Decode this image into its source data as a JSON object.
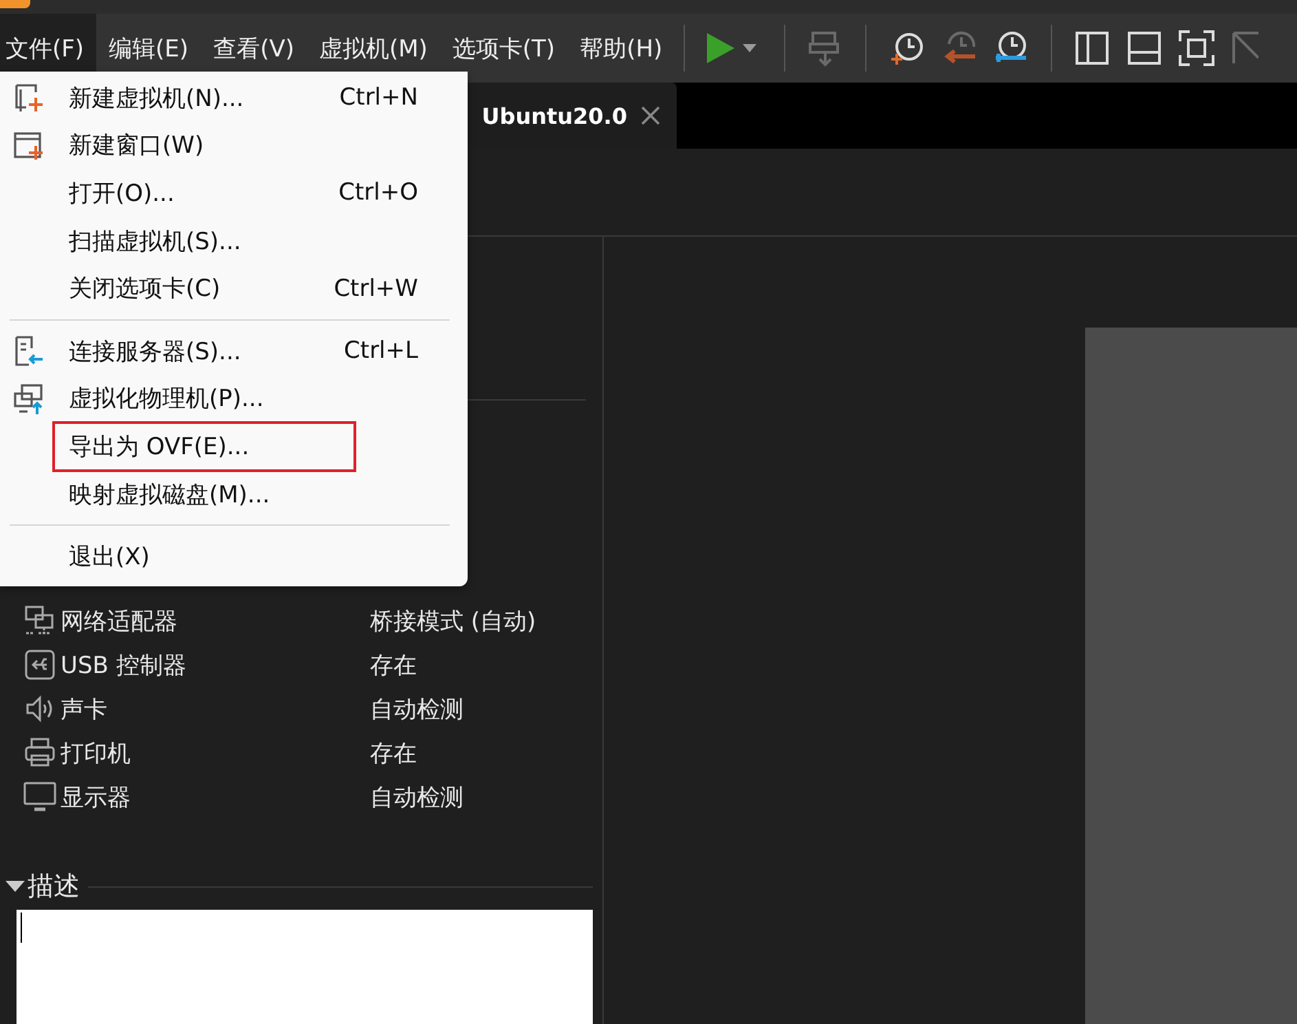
{
  "menubar": [
    {
      "label": "文件(F)",
      "selected": true
    },
    {
      "label": "编辑(E)",
      "selected": false
    },
    {
      "label": "查看(V)",
      "selected": false
    },
    {
      "label": "虚拟机(M)",
      "selected": false
    },
    {
      "label": "选项卡(T)",
      "selected": false
    },
    {
      "label": "帮助(H)",
      "selected": false
    }
  ],
  "toolbar": [
    {
      "kind": "play",
      "disabled": false
    },
    {
      "kind": "separator"
    },
    {
      "kind": "send",
      "disabled": true
    },
    {
      "kind": "separator"
    },
    {
      "kind": "snap-take",
      "disabled": false
    },
    {
      "kind": "snap-revert",
      "disabled": true
    },
    {
      "kind": "snap-manage",
      "disabled": false
    },
    {
      "kind": "separator"
    },
    {
      "kind": "sidebar",
      "disabled": false
    },
    {
      "kind": "bottom-panel",
      "disabled": false
    },
    {
      "kind": "fullscreen",
      "disabled": false
    },
    {
      "kind": "unity",
      "disabled": true
    }
  ],
  "tab": {
    "label": "Ubuntu20.0"
  },
  "file_menu": [
    {
      "kind": "item",
      "label": "新建虚拟机(N)...",
      "shortcut": "Ctrl+N",
      "annotated": false
    },
    {
      "kind": "item",
      "label": "新建窗口(W)",
      "annotated": false
    },
    {
      "kind": "item",
      "label": "打开(O)...",
      "shortcut": "Ctrl+O",
      "annotated": false
    },
    {
      "kind": "item",
      "label": "扫描虚拟机(S)...",
      "annotated": false
    },
    {
      "kind": "item",
      "label": "关闭选项卡(C)",
      "shortcut": "Ctrl+W",
      "annotated": false
    },
    {
      "kind": "separator"
    },
    {
      "kind": "item",
      "label": "连接服务器(S)...",
      "shortcut": "Ctrl+L",
      "annotated": false
    },
    {
      "kind": "item",
      "label": "虚拟化物理机(P)...",
      "annotated": false
    },
    {
      "kind": "item",
      "label": "导出为 OVF(E)...",
      "annotated": true
    },
    {
      "kind": "item",
      "label": "映射虚拟磁盘(M)...",
      "annotated": false
    },
    {
      "kind": "separator"
    },
    {
      "kind": "item",
      "label": "退出(X)",
      "annotated": false
    }
  ],
  "devices": [
    {
      "name": "网络适配器",
      "value": "桥接模式 (自动)"
    },
    {
      "name": "USB 控制器",
      "value": "存在"
    },
    {
      "name": "声卡",
      "value": "自动检测"
    },
    {
      "name": "打印机",
      "value": "存在"
    },
    {
      "name": "显示器",
      "value": "自动检测"
    }
  ],
  "description": {
    "title": "描述",
    "expanded": true
  }
}
